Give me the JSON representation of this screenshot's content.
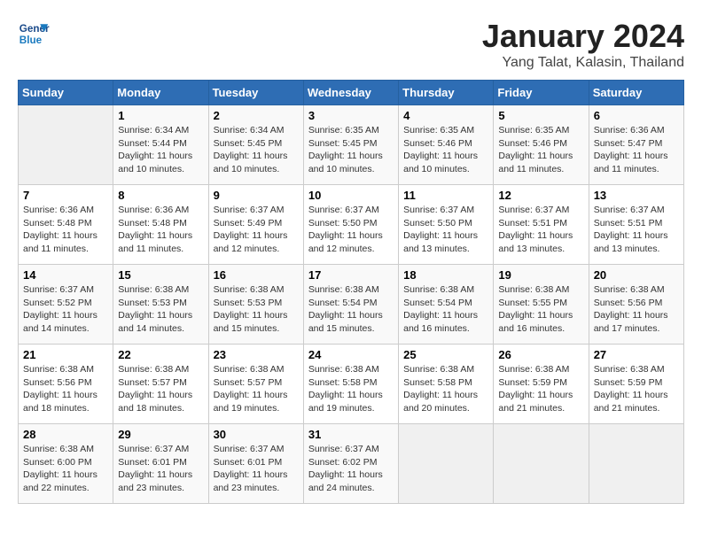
{
  "header": {
    "logo_line1": "General",
    "logo_line2": "Blue",
    "month": "January 2024",
    "location": "Yang Talat, Kalasin, Thailand"
  },
  "weekdays": [
    "Sunday",
    "Monday",
    "Tuesday",
    "Wednesday",
    "Thursday",
    "Friday",
    "Saturday"
  ],
  "weeks": [
    [
      {
        "day": "",
        "detail": ""
      },
      {
        "day": "1",
        "detail": "Sunrise: 6:34 AM\nSunset: 5:44 PM\nDaylight: 11 hours\nand 10 minutes."
      },
      {
        "day": "2",
        "detail": "Sunrise: 6:34 AM\nSunset: 5:45 PM\nDaylight: 11 hours\nand 10 minutes."
      },
      {
        "day": "3",
        "detail": "Sunrise: 6:35 AM\nSunset: 5:45 PM\nDaylight: 11 hours\nand 10 minutes."
      },
      {
        "day": "4",
        "detail": "Sunrise: 6:35 AM\nSunset: 5:46 PM\nDaylight: 11 hours\nand 10 minutes."
      },
      {
        "day": "5",
        "detail": "Sunrise: 6:35 AM\nSunset: 5:46 PM\nDaylight: 11 hours\nand 11 minutes."
      },
      {
        "day": "6",
        "detail": "Sunrise: 6:36 AM\nSunset: 5:47 PM\nDaylight: 11 hours\nand 11 minutes."
      }
    ],
    [
      {
        "day": "7",
        "detail": "Sunrise: 6:36 AM\nSunset: 5:48 PM\nDaylight: 11 hours\nand 11 minutes."
      },
      {
        "day": "8",
        "detail": "Sunrise: 6:36 AM\nSunset: 5:48 PM\nDaylight: 11 hours\nand 11 minutes."
      },
      {
        "day": "9",
        "detail": "Sunrise: 6:37 AM\nSunset: 5:49 PM\nDaylight: 11 hours\nand 12 minutes."
      },
      {
        "day": "10",
        "detail": "Sunrise: 6:37 AM\nSunset: 5:50 PM\nDaylight: 11 hours\nand 12 minutes."
      },
      {
        "day": "11",
        "detail": "Sunrise: 6:37 AM\nSunset: 5:50 PM\nDaylight: 11 hours\nand 13 minutes."
      },
      {
        "day": "12",
        "detail": "Sunrise: 6:37 AM\nSunset: 5:51 PM\nDaylight: 11 hours\nand 13 minutes."
      },
      {
        "day": "13",
        "detail": "Sunrise: 6:37 AM\nSunset: 5:51 PM\nDaylight: 11 hours\nand 13 minutes."
      }
    ],
    [
      {
        "day": "14",
        "detail": "Sunrise: 6:37 AM\nSunset: 5:52 PM\nDaylight: 11 hours\nand 14 minutes."
      },
      {
        "day": "15",
        "detail": "Sunrise: 6:38 AM\nSunset: 5:53 PM\nDaylight: 11 hours\nand 14 minutes."
      },
      {
        "day": "16",
        "detail": "Sunrise: 6:38 AM\nSunset: 5:53 PM\nDaylight: 11 hours\nand 15 minutes."
      },
      {
        "day": "17",
        "detail": "Sunrise: 6:38 AM\nSunset: 5:54 PM\nDaylight: 11 hours\nand 15 minutes."
      },
      {
        "day": "18",
        "detail": "Sunrise: 6:38 AM\nSunset: 5:54 PM\nDaylight: 11 hours\nand 16 minutes."
      },
      {
        "day": "19",
        "detail": "Sunrise: 6:38 AM\nSunset: 5:55 PM\nDaylight: 11 hours\nand 16 minutes."
      },
      {
        "day": "20",
        "detail": "Sunrise: 6:38 AM\nSunset: 5:56 PM\nDaylight: 11 hours\nand 17 minutes."
      }
    ],
    [
      {
        "day": "21",
        "detail": "Sunrise: 6:38 AM\nSunset: 5:56 PM\nDaylight: 11 hours\nand 18 minutes."
      },
      {
        "day": "22",
        "detail": "Sunrise: 6:38 AM\nSunset: 5:57 PM\nDaylight: 11 hours\nand 18 minutes."
      },
      {
        "day": "23",
        "detail": "Sunrise: 6:38 AM\nSunset: 5:57 PM\nDaylight: 11 hours\nand 19 minutes."
      },
      {
        "day": "24",
        "detail": "Sunrise: 6:38 AM\nSunset: 5:58 PM\nDaylight: 11 hours\nand 19 minutes."
      },
      {
        "day": "25",
        "detail": "Sunrise: 6:38 AM\nSunset: 5:58 PM\nDaylight: 11 hours\nand 20 minutes."
      },
      {
        "day": "26",
        "detail": "Sunrise: 6:38 AM\nSunset: 5:59 PM\nDaylight: 11 hours\nand 21 minutes."
      },
      {
        "day": "27",
        "detail": "Sunrise: 6:38 AM\nSunset: 5:59 PM\nDaylight: 11 hours\nand 21 minutes."
      }
    ],
    [
      {
        "day": "28",
        "detail": "Sunrise: 6:38 AM\nSunset: 6:00 PM\nDaylight: 11 hours\nand 22 minutes."
      },
      {
        "day": "29",
        "detail": "Sunrise: 6:37 AM\nSunset: 6:01 PM\nDaylight: 11 hours\nand 23 minutes."
      },
      {
        "day": "30",
        "detail": "Sunrise: 6:37 AM\nSunset: 6:01 PM\nDaylight: 11 hours\nand 23 minutes."
      },
      {
        "day": "31",
        "detail": "Sunrise: 6:37 AM\nSunset: 6:02 PM\nDaylight: 11 hours\nand 24 minutes."
      },
      {
        "day": "",
        "detail": ""
      },
      {
        "day": "",
        "detail": ""
      },
      {
        "day": "",
        "detail": ""
      }
    ]
  ]
}
